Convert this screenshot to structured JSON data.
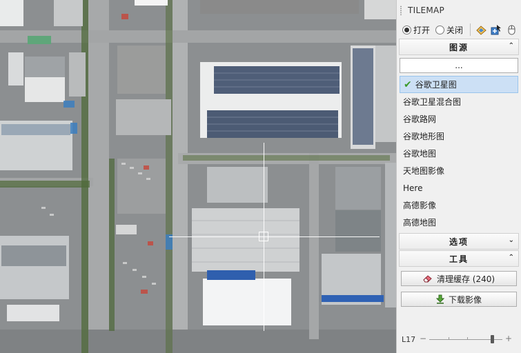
{
  "panel": {
    "title": "TILEMAP",
    "radio_open": "打开",
    "radio_close": "关闭",
    "radio_selected": "open",
    "tool_icons": [
      "layers-icon",
      "cursor-plus-icon",
      "mouse-icon"
    ]
  },
  "sections": {
    "map_source": "图源",
    "options": "选项",
    "tools": "工具"
  },
  "source": {
    "more_button": "...",
    "selected_index": 0,
    "items": [
      "谷歌卫星图",
      "谷歌卫星混合图",
      "谷歌路网",
      "谷歌地形图",
      "谷歌地图",
      "天地图影像",
      "Here",
      "高德影像",
      "高德地图"
    ]
  },
  "tools": {
    "clear_cache": "清理缓存 (240)",
    "download": "下载影像"
  },
  "zoom": {
    "label": "L17",
    "minus": "−",
    "plus": "+",
    "level_fraction": 0.88
  },
  "colors": {
    "selected_bg": "#cce0f5",
    "check_green": "#3b9a2a"
  }
}
